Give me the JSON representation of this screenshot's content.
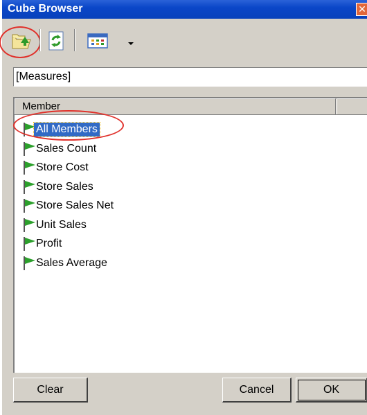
{
  "window": {
    "title": "Cube Browser"
  },
  "toolbar": {
    "buttons": [
      {
        "icon": "folder-open-up-icon"
      },
      {
        "icon": "refresh-icon"
      },
      {
        "icon": "grid-view-icon"
      }
    ]
  },
  "path": {
    "value": "[Measures]"
  },
  "list": {
    "columns": [
      "Member",
      ""
    ],
    "items": [
      {
        "label": "All Members",
        "selected": true
      },
      {
        "label": "Sales Count",
        "selected": false
      },
      {
        "label": "Store Cost",
        "selected": false
      },
      {
        "label": "Store Sales",
        "selected": false
      },
      {
        "label": "Store Sales Net",
        "selected": false
      },
      {
        "label": "Unit Sales",
        "selected": false
      },
      {
        "label": "Profit",
        "selected": false
      },
      {
        "label": "Sales Average",
        "selected": false
      }
    ]
  },
  "buttons": {
    "clear": "Clear",
    "cancel": "Cancel",
    "ok": "OK"
  },
  "colors": {
    "accent": "#316ac5",
    "flag": "#2ca02c",
    "highlight": "#e0302a"
  }
}
